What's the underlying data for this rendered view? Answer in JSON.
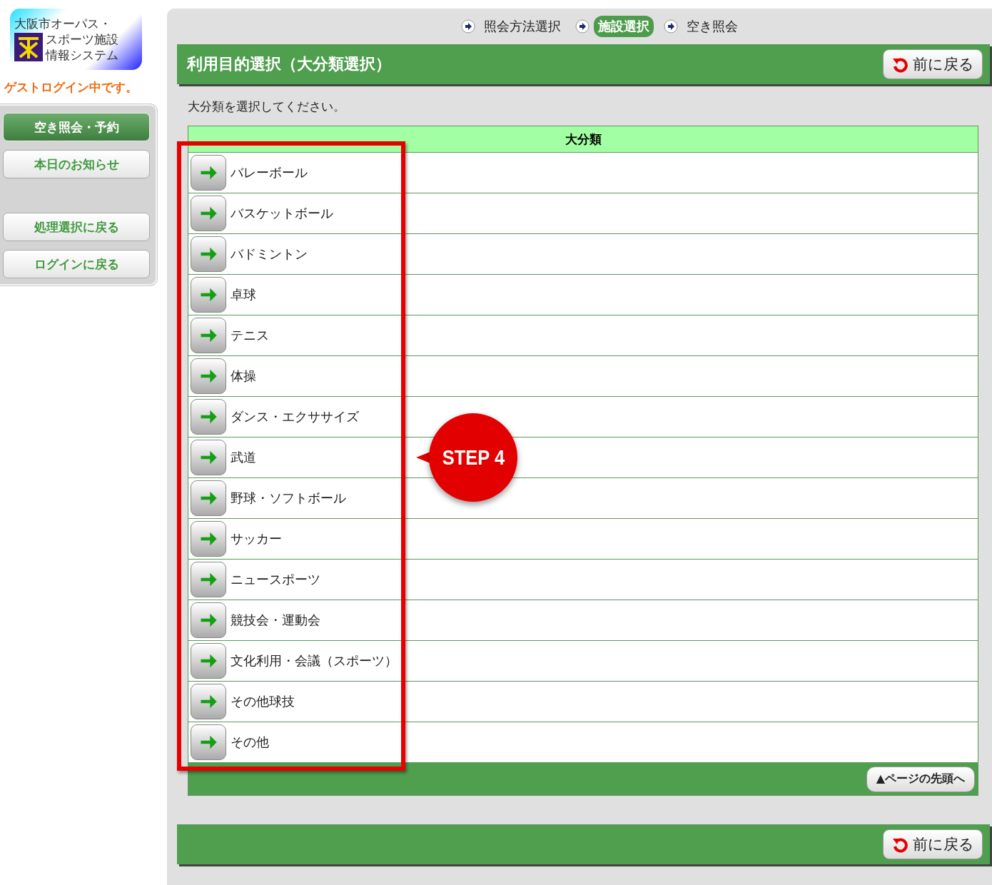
{
  "logo": {
    "lines": [
      "大阪市オーパス・",
      "スポーツ施設",
      "情報システム"
    ]
  },
  "login_status": "ゲストログイン中です。",
  "sidebar": {
    "menu": [
      {
        "label": "空き照会・予約",
        "selected": true
      },
      {
        "label": "本日のお知らせ",
        "selected": false
      }
    ],
    "nav": [
      "処理選択に戻る",
      "ログインに戻る"
    ]
  },
  "steps": [
    {
      "label": "照会方法選択",
      "selected": false
    },
    {
      "label": "施設選択",
      "selected": true
    },
    {
      "label": "空き照会",
      "selected": false
    }
  ],
  "header": {
    "title": "利用目的選択（大分類選択）",
    "back_button": "前に戻る"
  },
  "instruction": "大分類を選択してください。",
  "table": {
    "columns": [
      "大分類"
    ],
    "rows": [
      {
        "label": "バレーボール"
      },
      {
        "label": "バスケットボール"
      },
      {
        "label": "バドミントン"
      },
      {
        "label": "卓球"
      },
      {
        "label": "テニス"
      },
      {
        "label": "体操"
      },
      {
        "label": "ダンス・エクササイズ"
      },
      {
        "label": "武道"
      },
      {
        "label": "野球・ソフトボール"
      },
      {
        "label": "サッカー"
      },
      {
        "label": "ニュースポーツ"
      },
      {
        "label": "競技会・運動会"
      },
      {
        "label": "文化利用・会議（スポーツ）"
      },
      {
        "label": "その他球技"
      },
      {
        "label": "その他"
      }
    ],
    "page_top_button": "▲ページの先頭へ"
  },
  "footer": {
    "back_button": "前に戻る"
  },
  "annotation": {
    "label": "STEP 4"
  }
}
